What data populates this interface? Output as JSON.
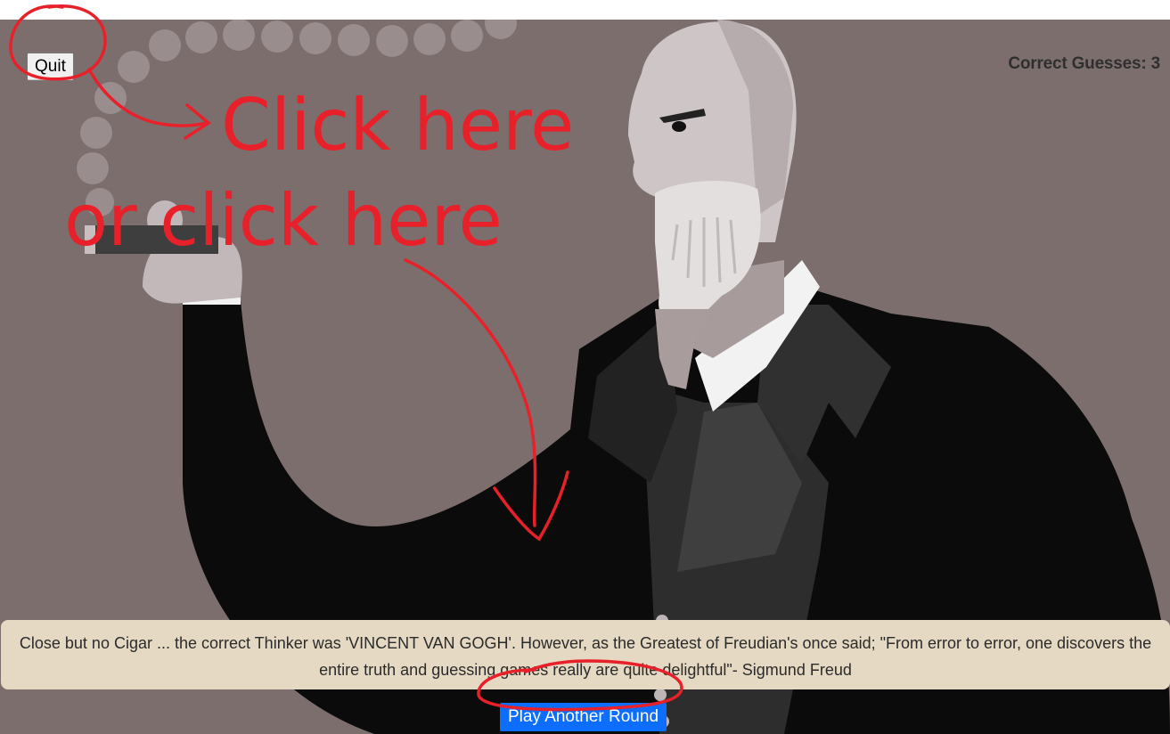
{
  "game": {
    "quit_label": "Quit",
    "score_label": "Correct Guesses:",
    "score_value": "3",
    "message": "Close but no Cigar ... the correct Thinker was 'VINCENT VAN GOGH'. However, as the Greatest of Freudian's once said; \"From error to error, one discovers the entire truth and guessing games really are quite delightful\"- Sigmund Freud",
    "play_again_label": "Play Another Round"
  },
  "annotations": {
    "line1": "Click here",
    "line2": "or click here",
    "color": "#e8202a"
  },
  "colors": {
    "background": "#7d6e6e",
    "message_box": "#e6d9c3",
    "primary_button": "#0d6efd"
  },
  "illustration": {
    "subject": "cartoon-freud-with-cigar"
  }
}
